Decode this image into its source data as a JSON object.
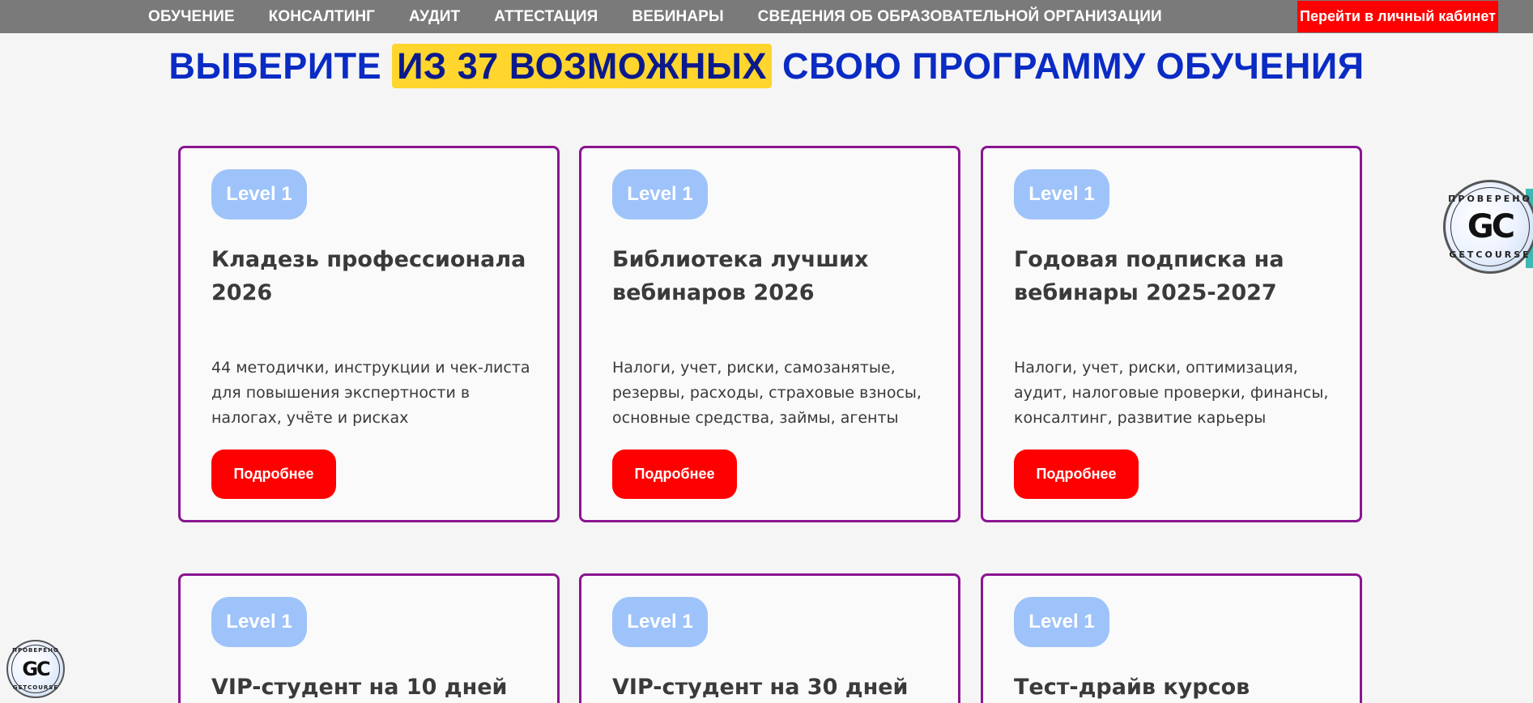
{
  "nav": {
    "items": [
      "ОБУЧЕНИЕ",
      "КОНСАЛТИНГ",
      "АУДИТ",
      "АТТЕСТАЦИЯ",
      "ВЕБИНАРЫ",
      "СВЕДЕНИЯ ОБ ОБРАЗОВАТЕЛЬНОЙ ОРГАНИЗАЦИИ"
    ],
    "cabinet_label": "Перейти в личный кабинет"
  },
  "heading": {
    "before": "ВЫБЕРИТЕ ",
    "highlight": "ИЗ 37 ВОЗМОЖНЫХ",
    "after": " СВОЮ ПРОГРАММУ ОБУЧЕНИЯ"
  },
  "cards": [
    {
      "badge": "Level 1",
      "title": "Кладезь профессионала 2026",
      "desc": "44 методички, инструкции и чек-листа для повышения экспертности в налогах, учёте и рисках",
      "button": "Подробнее"
    },
    {
      "badge": "Level 1",
      "title": "Библиотека лучших вебинаров 2026",
      "desc": "Налоги, учет, риски, самозанятые, резервы, расходы, страховые взносы, основные средства, займы, агенты",
      "button": "Подробнее"
    },
    {
      "badge": "Level 1",
      "title": "Годовая подписка на вебинары 2025-2027",
      "desc": "Налоги, учет, риски, оптимизация, аудит, налоговые проверки, финансы, консалтинг, развитие карьеры",
      "button": "Подробнее"
    },
    {
      "badge": "Level 1",
      "title": "VIP-студент на 10 дней"
    },
    {
      "badge": "Level 1",
      "title": "VIP-студент на 30 дней"
    },
    {
      "badge": "Level 1",
      "title": "Тест-драйв курсов"
    }
  ],
  "seal": {
    "logo": "GC",
    "top_text": "ПРОВЕРЕНО",
    "bottom_text": "GETCOURSE",
    "icon": "getcourse-seal-icon"
  },
  "colors": {
    "nav_bg": "#7a7a7a",
    "accent_red": "#ff0000",
    "heading_blue": "#0a2bc4",
    "highlight_yellow": "#ffd52e",
    "card_border": "#8a1591",
    "badge_blue": "#9ec3fa"
  }
}
